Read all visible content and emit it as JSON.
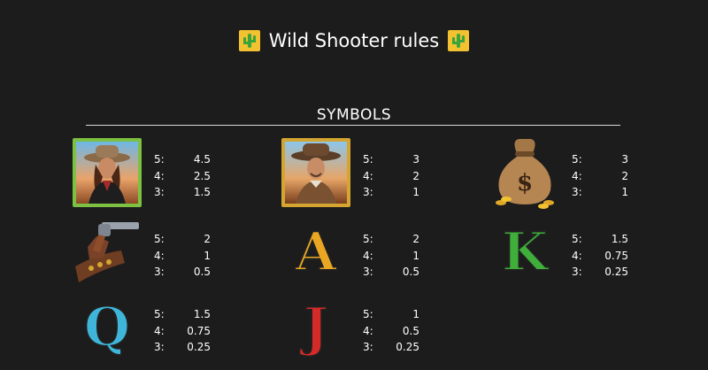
{
  "header": {
    "title": "Wild Shooter rules"
  },
  "symbols_section": {
    "title": "SYMBOLS"
  },
  "symbols": [
    {
      "icon": "cowgirl-symbol-icon",
      "pays": [
        {
          "count": "5:",
          "value": "4.5"
        },
        {
          "count": "4:",
          "value": "2.5"
        },
        {
          "count": "3:",
          "value": "1.5"
        }
      ]
    },
    {
      "icon": "cowboy-symbol-icon",
      "pays": [
        {
          "count": "5:",
          "value": "3"
        },
        {
          "count": "4:",
          "value": "2"
        },
        {
          "count": "3:",
          "value": "1"
        }
      ]
    },
    {
      "icon": "money-bag-symbol-icon",
      "pays": [
        {
          "count": "5:",
          "value": "3"
        },
        {
          "count": "4:",
          "value": "2"
        },
        {
          "count": "3:",
          "value": "1"
        }
      ]
    },
    {
      "icon": "revolver-holster-symbol-icon",
      "pays": [
        {
          "count": "5:",
          "value": "2"
        },
        {
          "count": "4:",
          "value": "1"
        },
        {
          "count": "3:",
          "value": "0.5"
        }
      ]
    },
    {
      "icon": "letter-a-symbol-icon",
      "letter": "A",
      "pays": [
        {
          "count": "5:",
          "value": "2"
        },
        {
          "count": "4:",
          "value": "1"
        },
        {
          "count": "3:",
          "value": "0.5"
        }
      ]
    },
    {
      "icon": "letter-k-symbol-icon",
      "letter": "K",
      "pays": [
        {
          "count": "5:",
          "value": "1.5"
        },
        {
          "count": "4:",
          "value": "0.75"
        },
        {
          "count": "3:",
          "value": "0.25"
        }
      ]
    },
    {
      "icon": "letter-q-symbol-icon",
      "letter": "Q",
      "pays": [
        {
          "count": "5:",
          "value": "1.5"
        },
        {
          "count": "4:",
          "value": "0.75"
        },
        {
          "count": "3:",
          "value": "0.25"
        }
      ]
    },
    {
      "icon": "letter-j-symbol-icon",
      "letter": "J",
      "pays": [
        {
          "count": "5:",
          "value": "1"
        },
        {
          "count": "4:",
          "value": "0.5"
        },
        {
          "count": "3:",
          "value": "0.25"
        }
      ]
    }
  ],
  "colors": {
    "background": "#1c1c1c",
    "frame_green": "#7cc142",
    "frame_gold": "#d4a531",
    "letter_a": "#e8a623",
    "letter_k": "#3fae3a",
    "letter_q": "#3fb6d9",
    "letter_j": "#d42a2a"
  }
}
